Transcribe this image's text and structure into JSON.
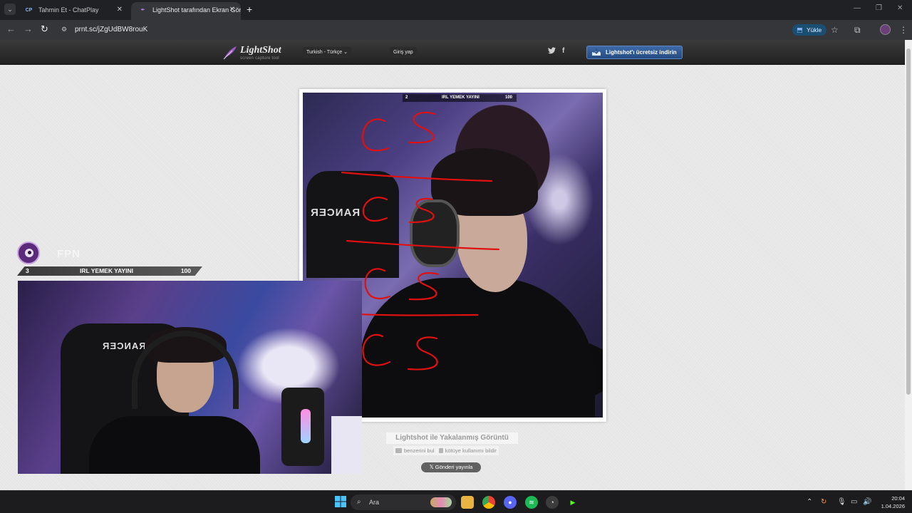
{
  "browser": {
    "tabs": [
      {
        "favicon": "CP",
        "title": "Tahmin Et - ChatPlay",
        "active": false
      },
      {
        "favicon": "feather-icon",
        "title": "LightShot tarafından Ekran Görü",
        "active": true
      }
    ],
    "new_tab_label": "+",
    "url": "prnt.sc/jZgUdBW8rouK",
    "install_label": "Yükle"
  },
  "lightshot": {
    "logo_name": "LightShot",
    "logo_sub": "screen capture tool",
    "language": "Turkish - Türkçe",
    "login": "Giriş yap",
    "twitter_glyph": "🐦",
    "facebook_glyph": "f",
    "download_button": "Lightshot'ı ücretsiz indirin",
    "caption_title": "Lightshot ile Yakalanmış Görüntü",
    "similar_link": "benzerini bul",
    "report_link": "kötüye kullanımı bildir",
    "tweet_button": "𝕏 Gönderi yayınla"
  },
  "screenshot": {
    "hud_left": "2",
    "hud_title": "IRL YEMEK YAYINI",
    "hud_right": "100",
    "chair_brand": "RANCER",
    "annotations": [
      "CS",
      "CS",
      "CS",
      "CS"
    ]
  },
  "overlay": {
    "bar_left": "3",
    "bar_title": "IRL YEMEK YAYINI",
    "bar_right": "100",
    "ghost_text": "FPN",
    "chair_brand": "RANCER"
  },
  "taskbar": {
    "search_label": "Ara",
    "time": "20:04",
    "date": "1.04.2026"
  },
  "colors": {
    "accent_blue": "#3e6aa8",
    "annotation_red": "#e01010",
    "page_bg": "#e6e6e6"
  }
}
